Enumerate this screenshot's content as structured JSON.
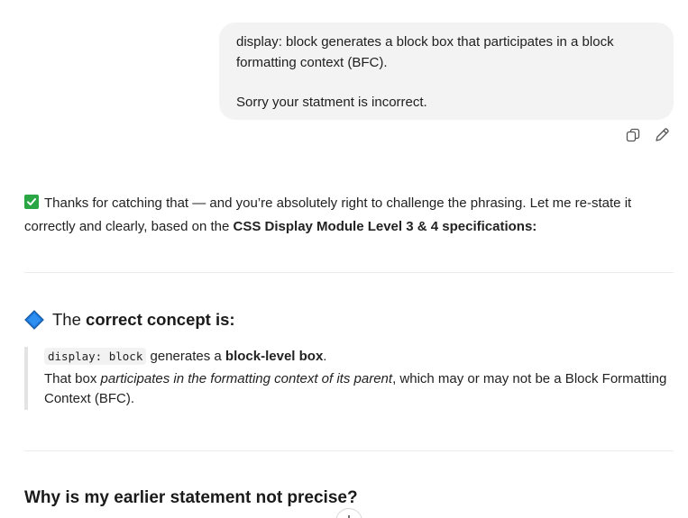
{
  "user_message": {
    "line1": "display: block generates a block box that participates in a block formatting context (BFC).",
    "line2": "Sorry your statment is incorrect."
  },
  "message_actions": {
    "copy_icon": "copy-icon",
    "edit_icon": "edit-pencil-icon"
  },
  "assistant": {
    "intro_emoji": "check-mark-button",
    "intro_text": "Thanks for catching that — and you’re absolutely right to challenge the phrasing. Let me re-state it correctly and clearly, based on the ",
    "intro_bold": "CSS Display Module Level 3 & 4 specifications:",
    "heading_icon": "blue-diamond-icon",
    "heading_prefix": "The ",
    "heading_bold": "correct concept",
    "heading_suffix": " is:",
    "quote": {
      "code": "display: block",
      "line1_mid": " generates a ",
      "line1_bold": "block-level box",
      "line1_end": ".",
      "line2_start": "That box ",
      "line2_italic": "participates in the formatting context of its parent",
      "line2_end": ", which may or may not be a Block Formatting Context (BFC)."
    },
    "subheading": "Why is my earlier statement not precise?"
  },
  "colors": {
    "bubble_bg": "#f3f3f3",
    "check_green": "#2aa744",
    "diamond_blue": "#1f7ae0",
    "quote_border": "#e3e3e3"
  }
}
